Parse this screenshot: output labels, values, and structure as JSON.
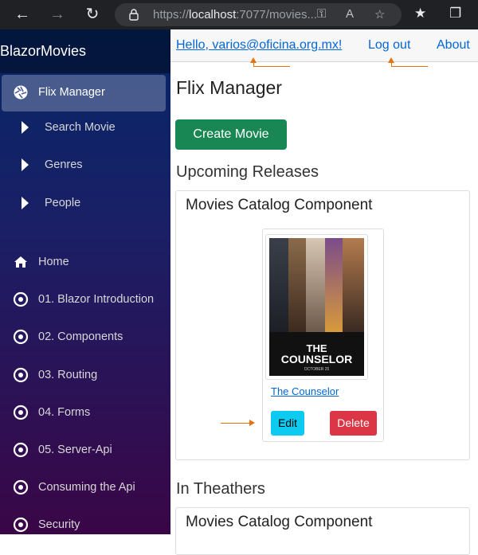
{
  "browser": {
    "url_host": "localhost",
    "url_rest": ":7077/movies...",
    "url_scheme": "https://"
  },
  "sidebar": {
    "brand": "BlazorMovies",
    "items": [
      {
        "label": "Flix Manager",
        "icon": "aperture-icon"
      },
      {
        "label": "Search Movie",
        "icon": "caret-right-icon"
      },
      {
        "label": "Genres",
        "icon": "caret-right-icon"
      },
      {
        "label": "People",
        "icon": "caret-right-icon"
      },
      {
        "label": "Home",
        "icon": "home-icon"
      },
      {
        "label": "01. Blazor Introduction",
        "icon": "target-icon"
      },
      {
        "label": "02. Components",
        "icon": "target-icon"
      },
      {
        "label": "03. Routing",
        "icon": "target-icon"
      },
      {
        "label": "04. Forms",
        "icon": "target-icon"
      },
      {
        "label": "05. Server-Api",
        "icon": "target-icon"
      },
      {
        "label": "Consuming the Api",
        "icon": "target-icon"
      },
      {
        "label": "Security",
        "icon": "target-icon"
      }
    ]
  },
  "topbar": {
    "user_link": "Hello, varios@oficina.org.mx!",
    "logout": "Log out",
    "about": "About"
  },
  "main": {
    "title": "Flix Manager",
    "create_button": "Create Movie",
    "sections": [
      {
        "heading": "Upcoming Releases",
        "catalog_title": "Movies Catalog Component",
        "movies": [
          {
            "title": "The Counselor",
            "poster_line1": "THE",
            "poster_line2": "COUNSELOR",
            "poster_date": "OCTOBER 25",
            "edit_label": "Edit",
            "delete_label": "Delete"
          }
        ]
      },
      {
        "heading": "In Theathers",
        "catalog_title": "Movies Catalog Component"
      }
    ]
  },
  "colors": {
    "accent_link": "#0366d6",
    "create_button": "#198754",
    "edit_button": "#0dcaf0",
    "delete_button": "#dc3545",
    "annotation_arrow": "#e8730c"
  }
}
